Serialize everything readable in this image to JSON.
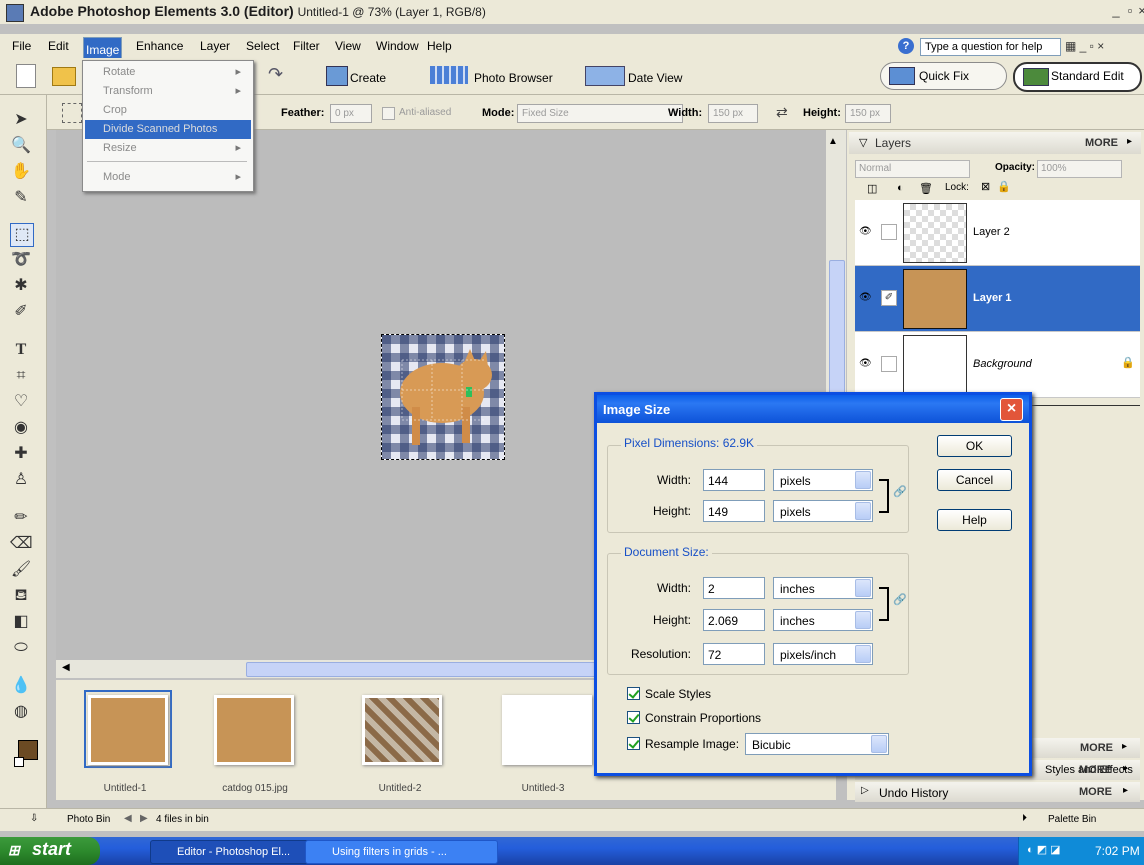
{
  "window": {
    "title": "Adobe Photoshop Elements 3.0 (Editor)",
    "subtitle": "Untitled-1 @ 73% (Layer 1, RGB/8)"
  },
  "menubar": {
    "items": [
      "File",
      "Edit",
      "Image",
      "Enhance",
      "Layer",
      "Select",
      "Filter",
      "View",
      "Window",
      "Help"
    ],
    "help_placeholder": "Type a question for help"
  },
  "shortcuts": {
    "create": "Create",
    "photo_browser": "Photo Browser",
    "date_view": "Date View",
    "quick_fix": "Quick Fix",
    "standard_edit": "Standard Edit"
  },
  "image_menu": {
    "items": [
      {
        "label": "Rotate",
        "submenu": true
      },
      {
        "label": "Transform",
        "submenu": true
      },
      {
        "label": "Crop",
        "submenu": false
      },
      {
        "label": "Divide Scanned Photos",
        "submenu": false
      },
      {
        "label": "Resize",
        "submenu": true
      },
      {
        "label": "Mode",
        "submenu": true
      }
    ]
  },
  "options": {
    "feather_label": "Feather:",
    "feather_value": "0 px",
    "anti_aliased": "Anti-aliased",
    "mode_label": "Mode:",
    "mode_value": "Fixed Size",
    "width_label": "Width:",
    "width_value": "150 px",
    "height_label": "Height:",
    "height_value": "150 px"
  },
  "layers_palette": {
    "title": "Layers",
    "more": "MORE",
    "blend_mode": "Normal",
    "opacity_label": "Opacity:",
    "opacity_value": "100%",
    "lock_label": "Lock:",
    "layers": [
      {
        "name": "Layer 2",
        "selected": false
      },
      {
        "name": "Layer 1",
        "selected": true
      },
      {
        "name": "Background",
        "selected": false
      }
    ]
  },
  "collapsed_palettes": {
    "more1": "MORE",
    "styles": "Styles and Effects",
    "more2": "MORE",
    "undo": "Undo History",
    "more3": "MORE"
  },
  "dialog": {
    "title": "Image Size",
    "pixel_dimensions_label": "Pixel Dimensions: 62.9K",
    "width_label": "Width:",
    "height_label": "Height:",
    "px_width": "144",
    "px_width_unit": "pixels",
    "px_height": "149",
    "px_height_unit": "pixels",
    "document_size_label": "Document Size:",
    "doc_width": "2",
    "doc_width_unit": "inches",
    "doc_height": "2.069",
    "doc_height_unit": "inches",
    "resolution_label": "Resolution:",
    "resolution": "72",
    "resolution_unit": "pixels/inch",
    "ok": "OK",
    "cancel": "Cancel",
    "help": "Help",
    "scale_styles": "Scale Styles",
    "constrain": "Constrain Proportions",
    "resample": "Resample Image:",
    "resample_value": "Bicubic"
  },
  "photo_bin": {
    "thumbs": [
      "Untitled-1",
      "catdog 015.jpg",
      "Untitled-2",
      "Untitled-3"
    ],
    "label": "Photo Bin",
    "count": "4 files in bin",
    "palette_bin": "Palette Bin"
  },
  "taskbar": {
    "start": "start",
    "task1": "Editor - Photoshop El...",
    "task2": "Using filters in grids - ...",
    "clock": "7:02 PM"
  },
  "colors": {
    "selection_blue": "#316ac5",
    "dialog_border": "#0b4ee2",
    "foreground_swatch": "#6b4a23"
  }
}
